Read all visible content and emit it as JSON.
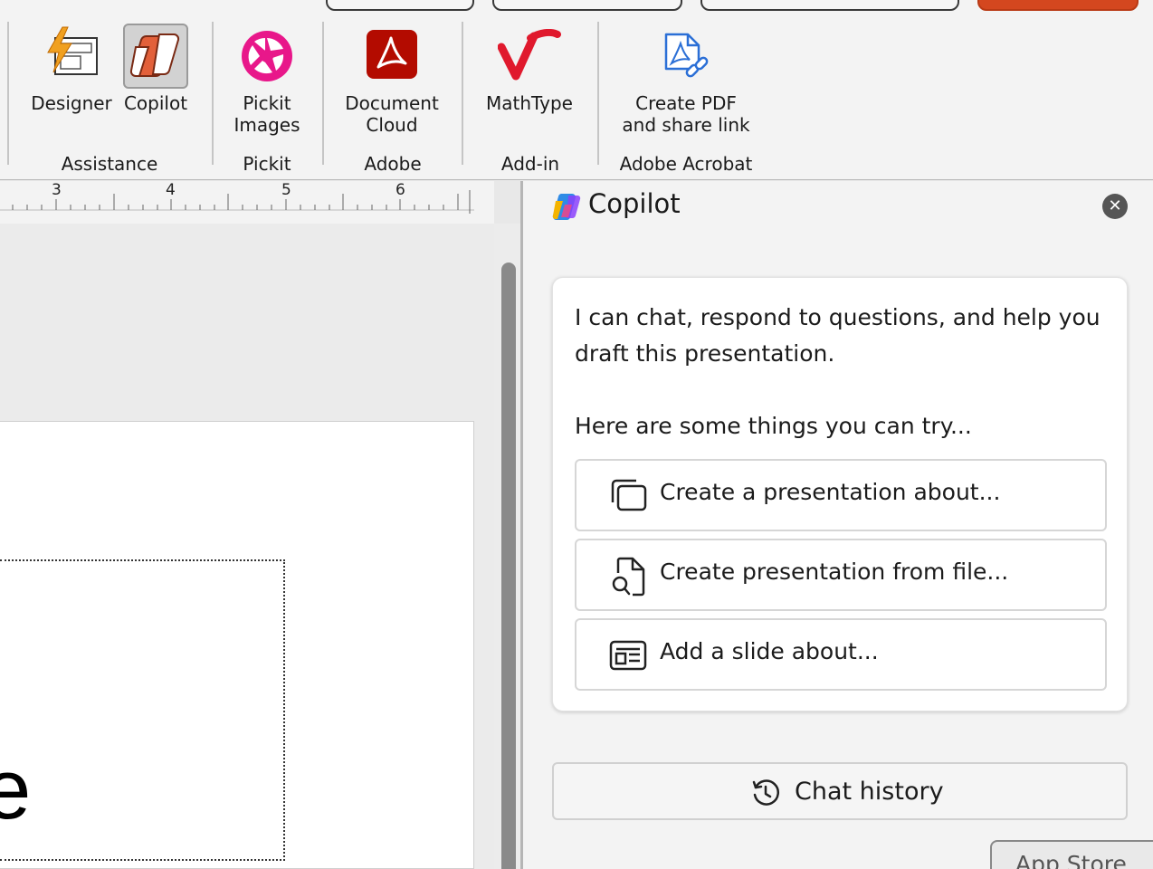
{
  "ribbon": {
    "buttons": {
      "designer": "Designer",
      "copilot": "Copilot",
      "pickit_images": "Pickit\nImages",
      "document_cloud": "Document\nCloud",
      "mathtype": "MathType",
      "create_pdf": "Create PDF\nand share link"
    },
    "groups": {
      "assistance": "Assistance",
      "pickit": "Pickit",
      "adobe": "Adobe",
      "addin": "Add-in",
      "adobe_acrobat": "Adobe Acrobat"
    }
  },
  "ruler": {
    "marks": [
      "3",
      "4",
      "5",
      "6"
    ]
  },
  "slide": {
    "visible_text_fragment": "e"
  },
  "copilot_pane": {
    "title": "Copilot",
    "close_icon": "close-icon",
    "intro": "I can chat, respond to questions, and help you draft this presentation.",
    "try_prompt": "Here are some things you can try...",
    "suggestions": [
      {
        "label": "Create a presentation about...",
        "icon": "slides-stack-icon"
      },
      {
        "label": "Create presentation from file...",
        "icon": "file-search-icon"
      },
      {
        "label": "Add a slide about...",
        "icon": "slide-layout-icon"
      }
    ],
    "chat_history_label": "Chat history",
    "app_store_label": "App Store"
  },
  "colors": {
    "pickit_magenta": "#e8178a",
    "adobe_red": "#b30b00",
    "mathtype_red": "#e0192d",
    "acrobat_blue": "#2b6fd6",
    "designer_orange": "#f0a020"
  }
}
